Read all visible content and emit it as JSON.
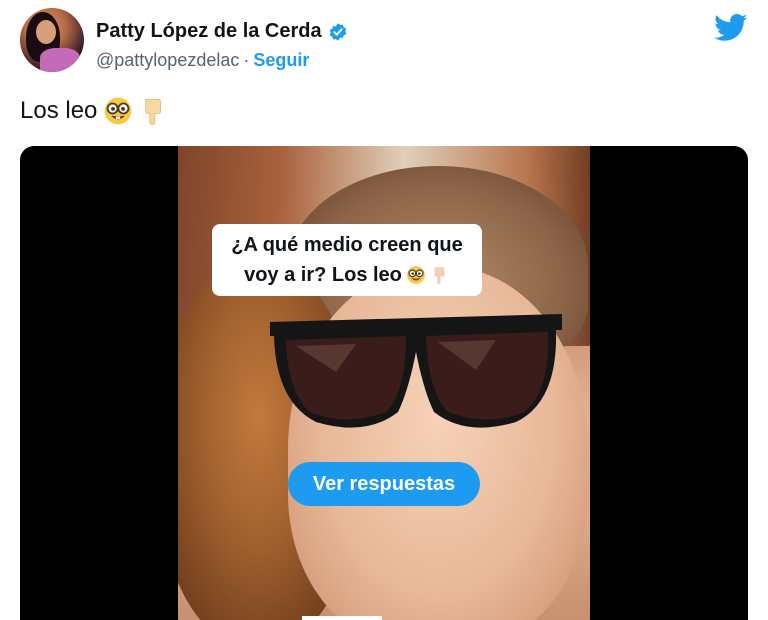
{
  "author": {
    "display_name": "Patty López de la Cerda",
    "handle": "@pattylopezdelac",
    "separator": "·",
    "follow_label": "Seguir",
    "verified_icon": "verified-badge-icon",
    "brand_icon": "twitter-bird-icon"
  },
  "tweet": {
    "text": "Los leo",
    "emojis": [
      "nerd-face-icon",
      "pointing-down-icon"
    ]
  },
  "media": {
    "overlay_question_line1": "¿A qué medio creen que",
    "overlay_question_line2": "voy a ir? Los leo",
    "replies_button_label": "Ver respuestas"
  },
  "colors": {
    "accent": "#1d9bf0",
    "text_primary": "#0f1419",
    "text_secondary": "#536471",
    "media_background": "#000000"
  }
}
